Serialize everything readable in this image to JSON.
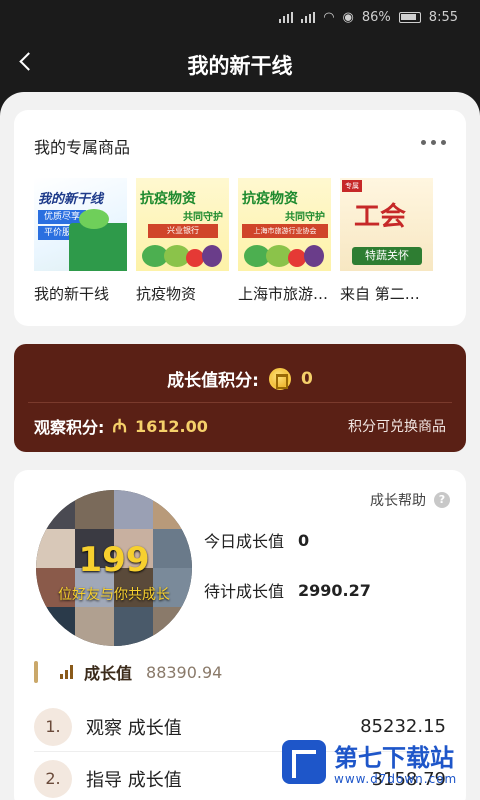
{
  "status": {
    "battery": "86%",
    "time": "8:55"
  },
  "header": {
    "title": "我的新干线"
  },
  "goods": {
    "title": "我的专属商品",
    "items": [
      {
        "name": "我的新干线",
        "thumb_text": [
          "我的新干线",
          "优质尽享",
          "平价服务"
        ]
      },
      {
        "name": "抗疫物资 ",
        "thumb_text": [
          "抗疫物资",
          "共同守护",
          "兴业银行"
        ]
      },
      {
        "name": "上海市旅游行业协会",
        "thumb_text": [
          "抗疫物资",
          "共同守护",
          "上海市旅游行业协会"
        ]
      },
      {
        "name": "来自 第二工会",
        "thumb_text": [
          "专属",
          "工会",
          "特蔬关怀"
        ]
      }
    ]
  },
  "points": {
    "growth_label": "成长值积分:",
    "growth_value": "0",
    "observe_label": "观察积分:",
    "observe_icon": "₼",
    "observe_value": "1612.00",
    "exchange_label": "积分可兑换商品"
  },
  "growth": {
    "help_label": "成长帮助",
    "help_icon": "?",
    "circle_number": "199",
    "circle_text": "位好友与你共成长",
    "today_label": "今日成长值",
    "today_value": "0",
    "pending_label": "待计成长值",
    "pending_value": "2990.27",
    "total_label": "成长值",
    "total_value": "88390.94",
    "ranks": [
      {
        "index": "1.",
        "label": "观察 成长值",
        "value": "85232.15"
      },
      {
        "index": "2.",
        "label": "指导 成长值",
        "value": "3158.79"
      }
    ]
  },
  "watermark": {
    "title": "第七下载站",
    "url": "www.d7down.com"
  },
  "colors": {
    "points_bg": "#5a2015",
    "gold": "#f5d06a",
    "sheet_bg": "#f2f2f2"
  }
}
